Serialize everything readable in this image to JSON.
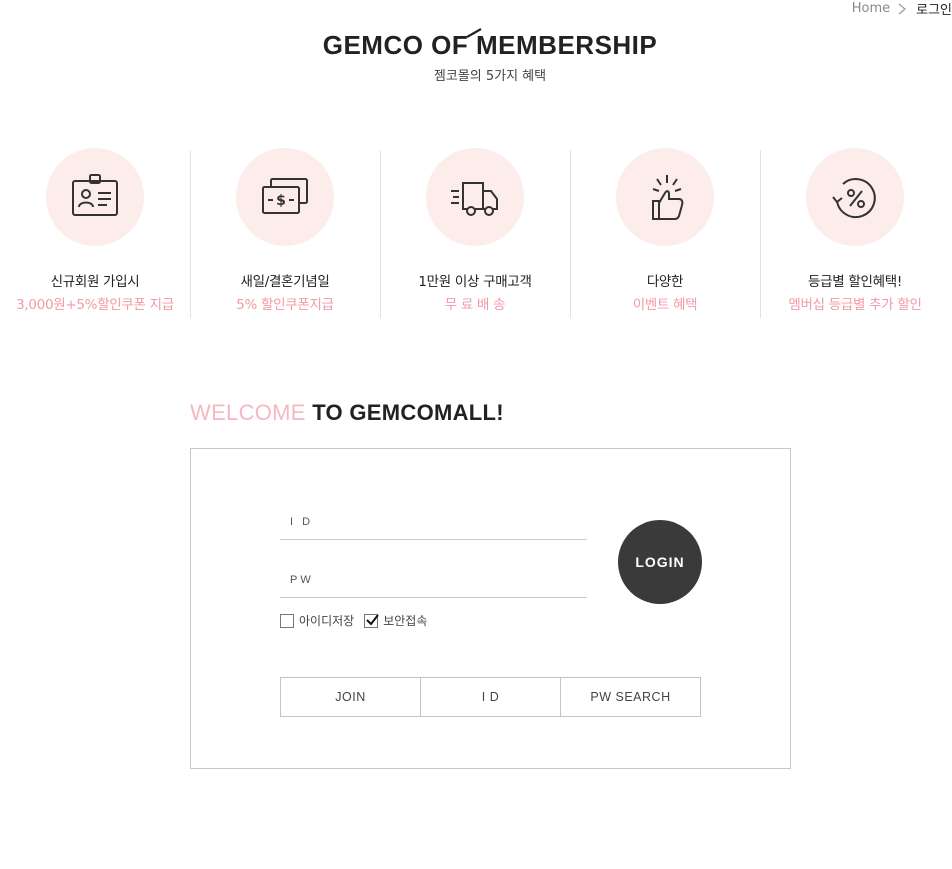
{
  "breadcrumb": {
    "home": "Home",
    "current": "로그인"
  },
  "brand": {
    "title": "GEMCO OF MEMBERSHIP",
    "subtitle": "젬코몰의 5가지 혜택"
  },
  "benefits": [
    {
      "icon": "id-card-icon",
      "title": "신규회원 가입시",
      "desc": "3,000원+5%할인쿠폰 지급"
    },
    {
      "icon": "money-icon",
      "title": "새일/결혼기념일",
      "desc": "5% 할인쿠폰지급"
    },
    {
      "icon": "delivery-truck-icon",
      "title": "1만원 이상 구매고객",
      "desc": "무 료 배 송"
    },
    {
      "icon": "thumbs-up-icon",
      "title": "다양한",
      "desc": "이벤트 혜택"
    },
    {
      "icon": "percent-refresh-icon",
      "title": "등급별 할인혜택!",
      "desc": "멤버십 등급별 추가 할인"
    }
  ],
  "welcome": {
    "highlight": "WELCOME",
    "rest": "TO GEMCOMALL!"
  },
  "login": {
    "id_placeholder": "I D",
    "pw_placeholder": "PW",
    "button": "LOGIN",
    "save_id": {
      "label": "아이디저장",
      "checked": false
    },
    "secure": {
      "label": "보안접속",
      "checked": true
    }
  },
  "actions": {
    "join": "JOIN",
    "id": "I D",
    "pw_search": "PW SEARCH"
  },
  "colors": {
    "accent_pink": "#f29aa5",
    "circle_bg": "#fcecea",
    "login_bg": "#3a3a3a"
  }
}
